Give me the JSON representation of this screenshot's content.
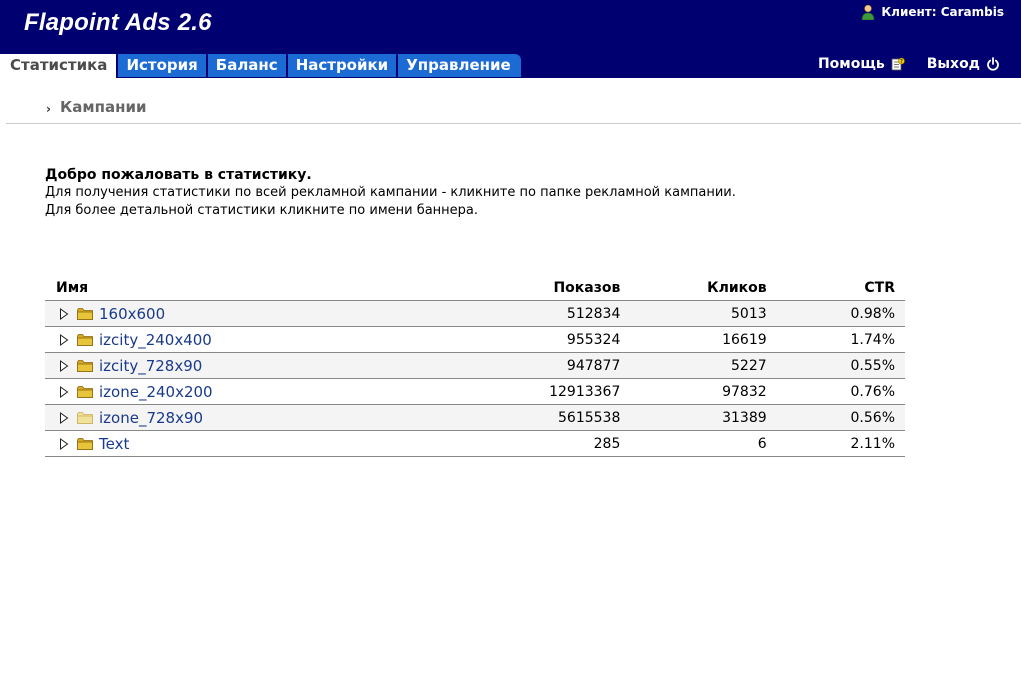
{
  "header": {
    "app_title": "Flapoint Ads 2.6",
    "client_label": "Клиент: Carambis",
    "help_label": "Помощь",
    "logout_label": "Выход"
  },
  "tabs": [
    {
      "label": "Статистика",
      "active": true
    },
    {
      "label": "История",
      "active": false
    },
    {
      "label": "Баланс",
      "active": false
    },
    {
      "label": "Настройки",
      "active": false
    },
    {
      "label": "Управление",
      "active": false
    }
  ],
  "breadcrumb": {
    "current": "Кампании"
  },
  "welcome": {
    "title": "Добро пожаловать в статистику.",
    "line1": "Для получения статистики по всей рекламной кампании - кликните по папке рекламной кампании.",
    "line2": "Для более детальной статистики кликните по имени баннера."
  },
  "table": {
    "headers": {
      "name": "Имя",
      "shows": "Показов",
      "clicks": "Кликов",
      "ctr": "CTR"
    },
    "rows": [
      {
        "name": "160x600",
        "shows": "512834",
        "clicks": "5013",
        "ctr": "0.98%",
        "folder": "normal"
      },
      {
        "name": "izcity_240x400",
        "shows": "955324",
        "clicks": "16619",
        "ctr": "1.74%",
        "folder": "normal"
      },
      {
        "name": "izcity_728x90",
        "shows": "947877",
        "clicks": "5227",
        "ctr": "0.55%",
        "folder": "normal"
      },
      {
        "name": "izone_240x200",
        "shows": "12913367",
        "clicks": "97832",
        "ctr": "0.76%",
        "folder": "normal"
      },
      {
        "name": "izone_728x90",
        "shows": "5615538",
        "clicks": "31389",
        "ctr": "0.56%",
        "folder": "pale"
      },
      {
        "name": "Text",
        "shows": "285",
        "clicks": "6",
        "ctr": "2.11%",
        "folder": "normal"
      }
    ]
  },
  "colors": {
    "header_bg": "#000070",
    "tab_bg": "#1c6ad3",
    "link": "#1a3a8c",
    "folder": "#e8c43a",
    "folder_pale": "#f1e29a"
  }
}
